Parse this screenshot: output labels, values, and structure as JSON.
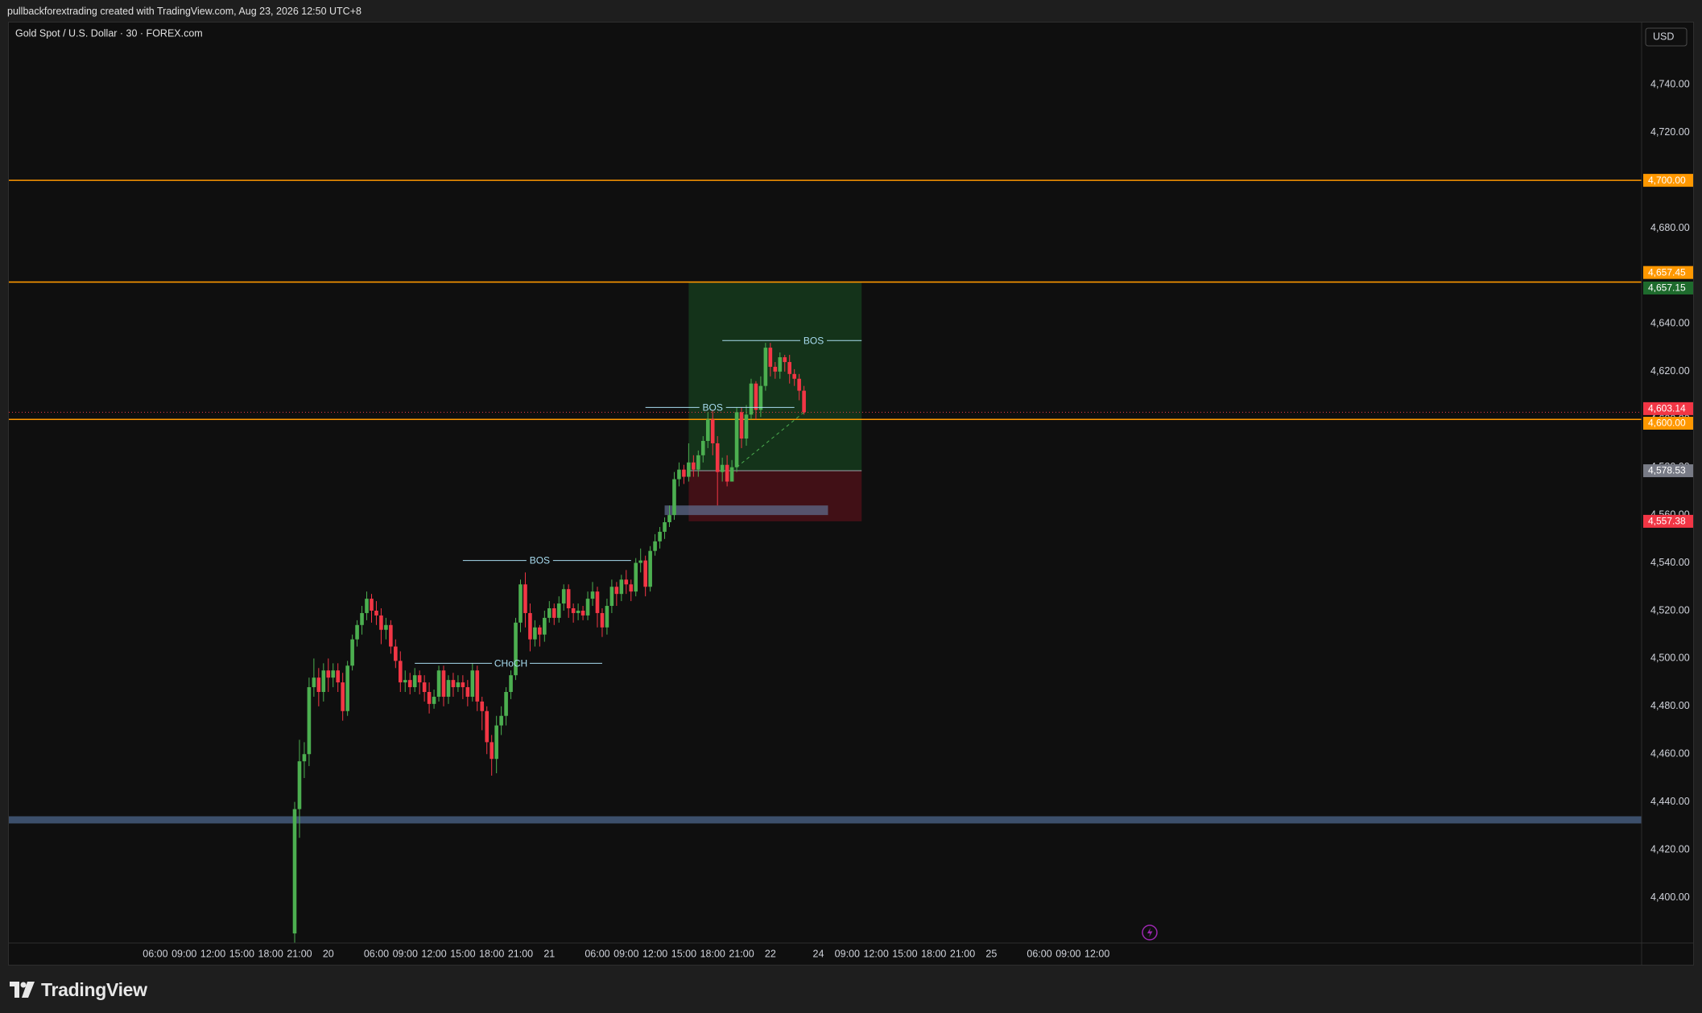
{
  "header": {
    "attribution": "pullbackforextrading created with TradingView.com, Aug 23, 2026 12:50 UTC+8"
  },
  "brand": {
    "name": "TradingView"
  },
  "colors": {
    "bull": "#4caf50",
    "bear": "#f23645",
    "orange": "#ff9800",
    "profit_zone": "#153a1c",
    "loss_zone": "#4a1118",
    "support_band": "#3c4f6b",
    "struct_line": "#a8dcf0"
  },
  "chart_data": {
    "type": "candlestick",
    "title": "Gold Spot / U.S. Dollar · 30 · FOREX.com",
    "currency": "USD",
    "ylim": [
      4381,
      4766
    ],
    "y_ticks": [
      4400,
      4420,
      4440,
      4460,
      4480,
      4500,
      4520,
      4540,
      4560,
      4580,
      4600,
      4620,
      4640,
      4680,
      4720,
      4740
    ],
    "x_ticks": [
      {
        "label": "06:00",
        "i": -29
      },
      {
        "label": "09:00",
        "i": -23
      },
      {
        "label": "12:00",
        "i": -17
      },
      {
        "label": "15:00",
        "i": -11
      },
      {
        "label": "18:00",
        "i": -5
      },
      {
        "label": "21:00",
        "i": 1
      },
      {
        "label": "20",
        "i": 7
      },
      {
        "label": "06:00",
        "i": 17
      },
      {
        "label": "09:00",
        "i": 23
      },
      {
        "label": "12:00",
        "i": 29
      },
      {
        "label": "15:00",
        "i": 35
      },
      {
        "label": "18:00",
        "i": 41
      },
      {
        "label": "21:00",
        "i": 47
      },
      {
        "label": "21",
        "i": 53
      },
      {
        "label": "06:00",
        "i": 63
      },
      {
        "label": "09:00",
        "i": 69
      },
      {
        "label": "12:00",
        "i": 75
      },
      {
        "label": "15:00",
        "i": 81
      },
      {
        "label": "18:00",
        "i": 87
      },
      {
        "label": "21:00",
        "i": 93
      },
      {
        "label": "22",
        "i": 99
      },
      {
        "label": "24",
        "i": 109
      },
      {
        "label": "09:00",
        "i": 115
      },
      {
        "label": "12:00",
        "i": 121
      },
      {
        "label": "15:00",
        "i": 127
      },
      {
        "label": "18:00",
        "i": 133
      },
      {
        "label": "21:00",
        "i": 139
      },
      {
        "label": "25",
        "i": 145
      },
      {
        "label": "06:00",
        "i": 155
      },
      {
        "label": "09:00",
        "i": 161
      },
      {
        "label": "12:00",
        "i": 167
      }
    ],
    "candles": [
      [
        4385,
        4437,
        4380,
        4440
      ],
      [
        4437,
        4457,
        4425,
        4466
      ],
      [
        4457,
        4460,
        4450,
        4465
      ],
      [
        4460,
        4488,
        4455,
        4492
      ],
      [
        4488,
        4492,
        4484,
        4500
      ],
      [
        4492,
        4486,
        4480,
        4496
      ],
      [
        4486,
        4495,
        4482,
        4498
      ],
      [
        4495,
        4492,
        4486,
        4500
      ],
      [
        4492,
        4495,
        4488,
        4498
      ],
      [
        4495,
        4490,
        4486,
        4498
      ],
      [
        4490,
        4478,
        4474,
        4494
      ],
      [
        4478,
        4497,
        4476,
        4499
      ],
      [
        4497,
        4508,
        4495,
        4510
      ],
      [
        4508,
        4514,
        4505,
        4516
      ],
      [
        4514,
        4519,
        4510,
        4522
      ],
      [
        4519,
        4525,
        4516,
        4528
      ],
      [
        4525,
        4520,
        4515,
        4527
      ],
      [
        4520,
        4518,
        4514,
        4524
      ],
      [
        4518,
        4512,
        4506,
        4521
      ],
      [
        4512,
        4514,
        4508,
        4517
      ],
      [
        4514,
        4505,
        4502,
        4516
      ],
      [
        4505,
        4499,
        4496,
        4508
      ],
      [
        4499,
        4490,
        4486,
        4503
      ],
      [
        4490,
        4491,
        4486,
        4495
      ],
      [
        4491,
        4488,
        4485,
        4494
      ],
      [
        4488,
        4493,
        4486,
        4496
      ],
      [
        4493,
        4490,
        4485,
        4495
      ],
      [
        4490,
        4486,
        4482,
        4493
      ],
      [
        4486,
        4481,
        4477,
        4490
      ],
      [
        4481,
        4484,
        4479,
        4487
      ],
      [
        4484,
        4495,
        4482,
        4497
      ],
      [
        4495,
        4484,
        4480,
        4497
      ],
      [
        4484,
        4491,
        4481,
        4493
      ],
      [
        4491,
        4488,
        4484,
        4494
      ],
      [
        4488,
        4490,
        4486,
        4493
      ],
      [
        4490,
        4488,
        4483,
        4493
      ],
      [
        4488,
        4484,
        4480,
        4491
      ],
      [
        4484,
        4495,
        4482,
        4498
      ],
      [
        4495,
        4482,
        4478,
        4497
      ],
      [
        4482,
        4478,
        4470,
        4484
      ],
      [
        4478,
        4465,
        4460,
        4480
      ],
      [
        4465,
        4458,
        4451,
        4468
      ],
      [
        4458,
        4472,
        4452,
        4476
      ],
      [
        4472,
        4476,
        4468,
        4480
      ],
      [
        4476,
        4486,
        4472,
        4488
      ],
      [
        4486,
        4493,
        4483,
        4495
      ],
      [
        4493,
        4515,
        4491,
        4517
      ],
      [
        4515,
        4531,
        4511,
        4533
      ],
      [
        4531,
        4519,
        4513,
        4536
      ],
      [
        4519,
        4508,
        4503,
        4523
      ],
      [
        4508,
        4513,
        4505,
        4516
      ],
      [
        4513,
        4510,
        4505,
        4514
      ],
      [
        4510,
        4517,
        4507,
        4520
      ],
      [
        4517,
        4521,
        4515,
        4524
      ],
      [
        4521,
        4517,
        4514,
        4523
      ],
      [
        4517,
        4523,
        4515,
        4526
      ],
      [
        4523,
        4529,
        4520,
        4531
      ],
      [
        4529,
        4521,
        4517,
        4531
      ],
      [
        4521,
        4519,
        4515,
        4523
      ],
      [
        4519,
        4520,
        4516,
        4523
      ],
      [
        4520,
        4518,
        4516,
        4522
      ],
      [
        4518,
        4525,
        4516,
        4528
      ],
      [
        4525,
        4528,
        4522,
        4532
      ],
      [
        4528,
        4519,
        4513,
        4530
      ],
      [
        4519,
        4513,
        4509,
        4521
      ],
      [
        4513,
        4522,
        4510,
        4525
      ],
      [
        4522,
        4530,
        4519,
        4533
      ],
      [
        4530,
        4527,
        4522,
        4532
      ],
      [
        4527,
        4533,
        4524,
        4535
      ],
      [
        4533,
        4531,
        4527,
        4537
      ],
      [
        4531,
        4528,
        4524,
        4533
      ],
      [
        4528,
        4540,
        4526,
        4542
      ],
      [
        4540,
        4541,
        4536,
        4546
      ],
      [
        4541,
        4530,
        4526,
        4543
      ],
      [
        4530,
        4545,
        4528,
        4547
      ],
      [
        4545,
        4549,
        4543,
        4552
      ],
      [
        4549,
        4553,
        4546,
        4555
      ],
      [
        4553,
        4557,
        4550,
        4559
      ],
      [
        4557,
        4560,
        4555,
        4564
      ],
      [
        4560,
        4575,
        4558,
        4578
      ],
      [
        4575,
        4579,
        4572,
        4582
      ],
      [
        4579,
        4576,
        4573,
        4581
      ],
      [
        4576,
        4582,
        4574,
        4590
      ],
      [
        4582,
        4579,
        4576,
        4585
      ],
      [
        4579,
        4585,
        4576,
        4587
      ],
      [
        4585,
        4591,
        4582,
        4593
      ],
      [
        4591,
        4600,
        4588,
        4603
      ],
      [
        4600,
        4590,
        4585,
        4604
      ],
      [
        4590,
        4578,
        4564,
        4593
      ],
      [
        4578,
        4581,
        4574,
        4584
      ],
      [
        4581,
        4574,
        4572,
        4585
      ],
      [
        4574,
        4580,
        4575,
        4583
      ],
      [
        4580,
        4603,
        4578,
        4605
      ],
      [
        4603,
        4592,
        4588,
        4605
      ],
      [
        4592,
        4602,
        4589,
        4606
      ],
      [
        4602,
        4615,
        4600,
        4617
      ],
      [
        4615,
        4604,
        4600,
        4616
      ],
      [
        4604,
        4614,
        4601,
        4618
      ],
      [
        4614,
        4630,
        4612,
        4632
      ],
      [
        4630,
        4622,
        4618,
        4632
      ],
      [
        4622,
        4620,
        4617,
        4624
      ],
      [
        4620,
        4626,
        4617,
        4628
      ],
      [
        4626,
        4624,
        4620,
        4627
      ],
      [
        4624,
        4619,
        4615,
        4627
      ],
      [
        4619,
        4617,
        4614,
        4621
      ],
      [
        4617,
        4612,
        4608,
        4619
      ],
      [
        4612,
        4603,
        4602,
        4614
      ]
    ],
    "h_lines": [
      {
        "price": 4700.0,
        "label": "4,700.00"
      },
      {
        "price": 4657.45,
        "label": "4,657.45"
      },
      {
        "price": 4600.0,
        "label": "4,600.00"
      }
    ],
    "price_tags": {
      "target": "4,657.15",
      "current": "4,603.14",
      "entry": "4,578.53",
      "stop": "4,557.38"
    },
    "position": {
      "entry": 4578.53,
      "target": 4657.15,
      "stop": 4557.38,
      "start_i": 82,
      "end_i": 118
    },
    "support_band": {
      "low": 4431,
      "high": 4434
    },
    "order_block": {
      "low": 4560,
      "high": 4564,
      "start_i": 77,
      "end_i": 111
    },
    "structure": [
      {
        "label": "CHoCH",
        "price": 4498,
        "start_i": 25,
        "end_i": 64,
        "label_i": 45
      },
      {
        "label": "BOS",
        "price": 4541,
        "start_i": 35,
        "end_i": 70,
        "label_i": 51
      },
      {
        "label": "BOS",
        "price": 4605,
        "start_i": 73,
        "end_i": 104,
        "label_i": 87
      },
      {
        "label": "BOS",
        "price": 4633,
        "start_i": 89,
        "end_i": 118,
        "label_i": 108
      }
    ]
  }
}
